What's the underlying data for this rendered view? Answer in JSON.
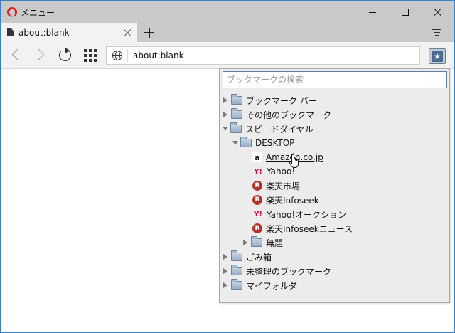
{
  "window": {
    "title": "メニュー"
  },
  "tab": {
    "label": "about:blank"
  },
  "address": {
    "url": "about:blank"
  },
  "bookmarks_popup": {
    "search_placeholder": "ブックマークの検索",
    "items": [
      {
        "label": "ブックマーク バー",
        "kind": "folder",
        "expanded": false,
        "depth": 0
      },
      {
        "label": "その他のブックマーク",
        "kind": "folder",
        "expanded": false,
        "depth": 0
      },
      {
        "label": "スピードダイヤル",
        "kind": "folder",
        "expanded": true,
        "depth": 0
      },
      {
        "label": "DESKTOP",
        "kind": "folder",
        "expanded": true,
        "depth": 1
      },
      {
        "label": "Amazon.co.jp",
        "kind": "link",
        "icon": "amazon-icon",
        "depth": 2
      },
      {
        "label": "Yahoo!",
        "kind": "link",
        "icon": "yahoo-icon",
        "depth": 2
      },
      {
        "label": "楽天市場",
        "kind": "link",
        "icon": "rakuten-icon",
        "depth": 2
      },
      {
        "label": "楽天Infoseek",
        "kind": "link",
        "icon": "rakuten-icon",
        "depth": 2
      },
      {
        "label": "Yahoo!オークション",
        "kind": "link",
        "icon": "yahoo-icon",
        "depth": 2
      },
      {
        "label": "楽天Infoseekニュース",
        "kind": "link",
        "icon": "rakuten-icon",
        "depth": 2
      },
      {
        "label": "無題",
        "kind": "folder",
        "expanded": false,
        "depth": 2
      },
      {
        "label": "ごみ箱",
        "kind": "folder",
        "expanded": false,
        "depth": 0
      },
      {
        "label": "未整理のブックマーク",
        "kind": "folder",
        "expanded": false,
        "depth": 0
      },
      {
        "label": "マイフォルダ",
        "kind": "folder",
        "expanded": false,
        "depth": 0
      }
    ]
  },
  "icons": {
    "amazon": "a",
    "yahoo": "Y!",
    "rakuten": "R",
    "bookmarks_button": "★"
  },
  "colors": {
    "frame": "#c9c9c9",
    "toolbar": "#f2f2f2",
    "popup_bg": "#ececec",
    "search_border": "#5e7fa6",
    "opera_red": "#d8221f",
    "rakuten_red": "#b5322b",
    "yahoo_red": "#e60033"
  }
}
